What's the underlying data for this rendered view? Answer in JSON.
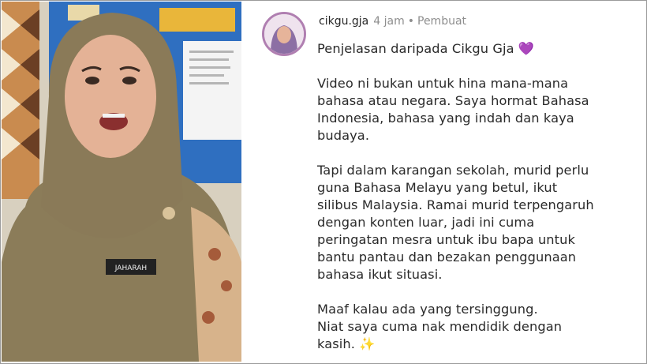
{
  "comment": {
    "username": "cikgu.gja",
    "time": "4 jam",
    "separator": "•",
    "role": "Pembuat",
    "heading": "Penjelasan daripada Cikgu Gja 💜",
    "paragraph1": "Video ni bukan untuk hina mana-mana\nbahasa atau negara. Saya hormat Bahasa\nIndonesia, bahasa yang indah dan kaya\nbudaya.",
    "paragraph2": "Tapi dalam karangan sekolah, murid perlu\nguna Bahasa Melayu yang betul, ikut\nsilibus Malaysia. Ramai murid terpengaruh\ndengan konten luar, jadi ini cuma\nperingatan mesra untuk ibu bapa untuk\nbantu pantau dan bezakan penggunaan\nbahasa ikut situasi.",
    "paragraph3": "Maaf kalau ada yang tersinggung.\nNiat saya cuma nak mendidik dengan\nkasih. ✨"
  },
  "video": {
    "name_tag": "JAHARAH"
  },
  "colors": {
    "hijab": "#8a7a58",
    "avatar_ring": "#b07fb1",
    "board_blue": "#2f6fc0"
  }
}
